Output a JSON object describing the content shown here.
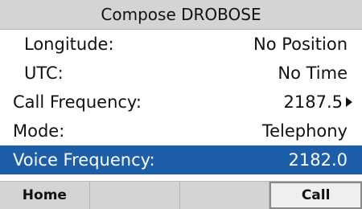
{
  "title": "Compose DROBOSE",
  "rows": [
    {
      "label": "Longitude:",
      "value": "No Position"
    },
    {
      "label": "UTC:",
      "value": "No Time"
    },
    {
      "label": "Call Frequency:",
      "value": "2187.5"
    },
    {
      "label": "Mode:",
      "value": "Telephony"
    },
    {
      "label": "Voice Frequency:",
      "value": "2182.0"
    }
  ],
  "softkeys": [
    "Home",
    "",
    "",
    "Call"
  ],
  "colors": {
    "selected": "#1c5ea8",
    "title_bg": "#d4d4d4"
  }
}
